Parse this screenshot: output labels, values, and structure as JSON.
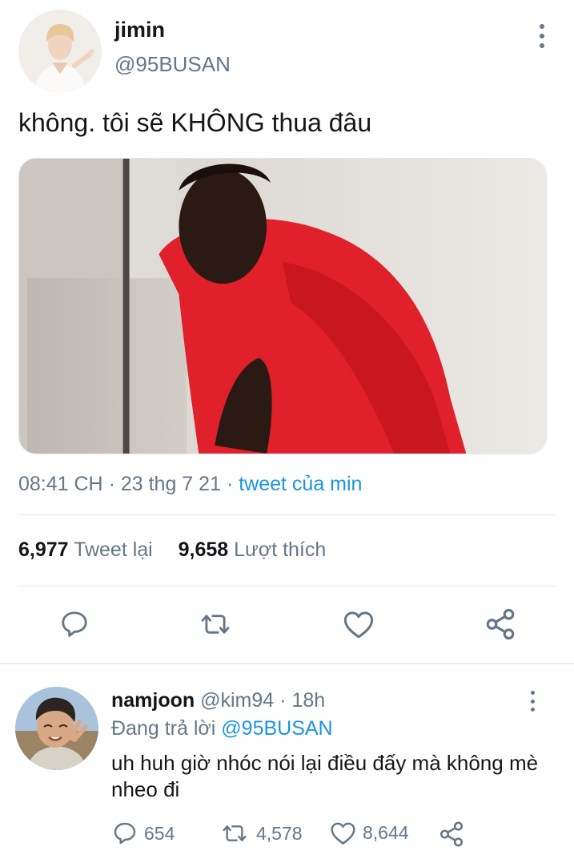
{
  "tweet": {
    "author_name": "jimin",
    "author_handle": "@95BUSAN",
    "text": "không. tôi sẽ KHÔNG thua đâu",
    "time": "08:41 CH",
    "date": "23 thg 7 21",
    "source": "tweet của min",
    "retweet_count": "6,977",
    "retweet_label": "Tweet lại",
    "like_count": "9,658",
    "like_label": "Lượt thích"
  },
  "reply": {
    "author_name": "namjoon",
    "author_handle": "@kim94",
    "time": "18h",
    "replying_prefix": "Đang trả lời",
    "replying_to": "@95BUSAN",
    "text": "uh huh giờ nhóc nói lại điều đấy mà không mè nheo đi",
    "reply_count": "654",
    "retweet_count": "4,578",
    "like_count": "8,644"
  },
  "icons": {
    "reply": "speech-bubble-icon",
    "retweet": "retweet-arrows-icon",
    "like": "heart-icon",
    "share": "share-icon",
    "more": "vertical-ellipsis-icon"
  },
  "colors": {
    "text": "#14171a",
    "secondary": "#657786",
    "link": "#1b95e0",
    "divider": "#e1e8ed"
  }
}
